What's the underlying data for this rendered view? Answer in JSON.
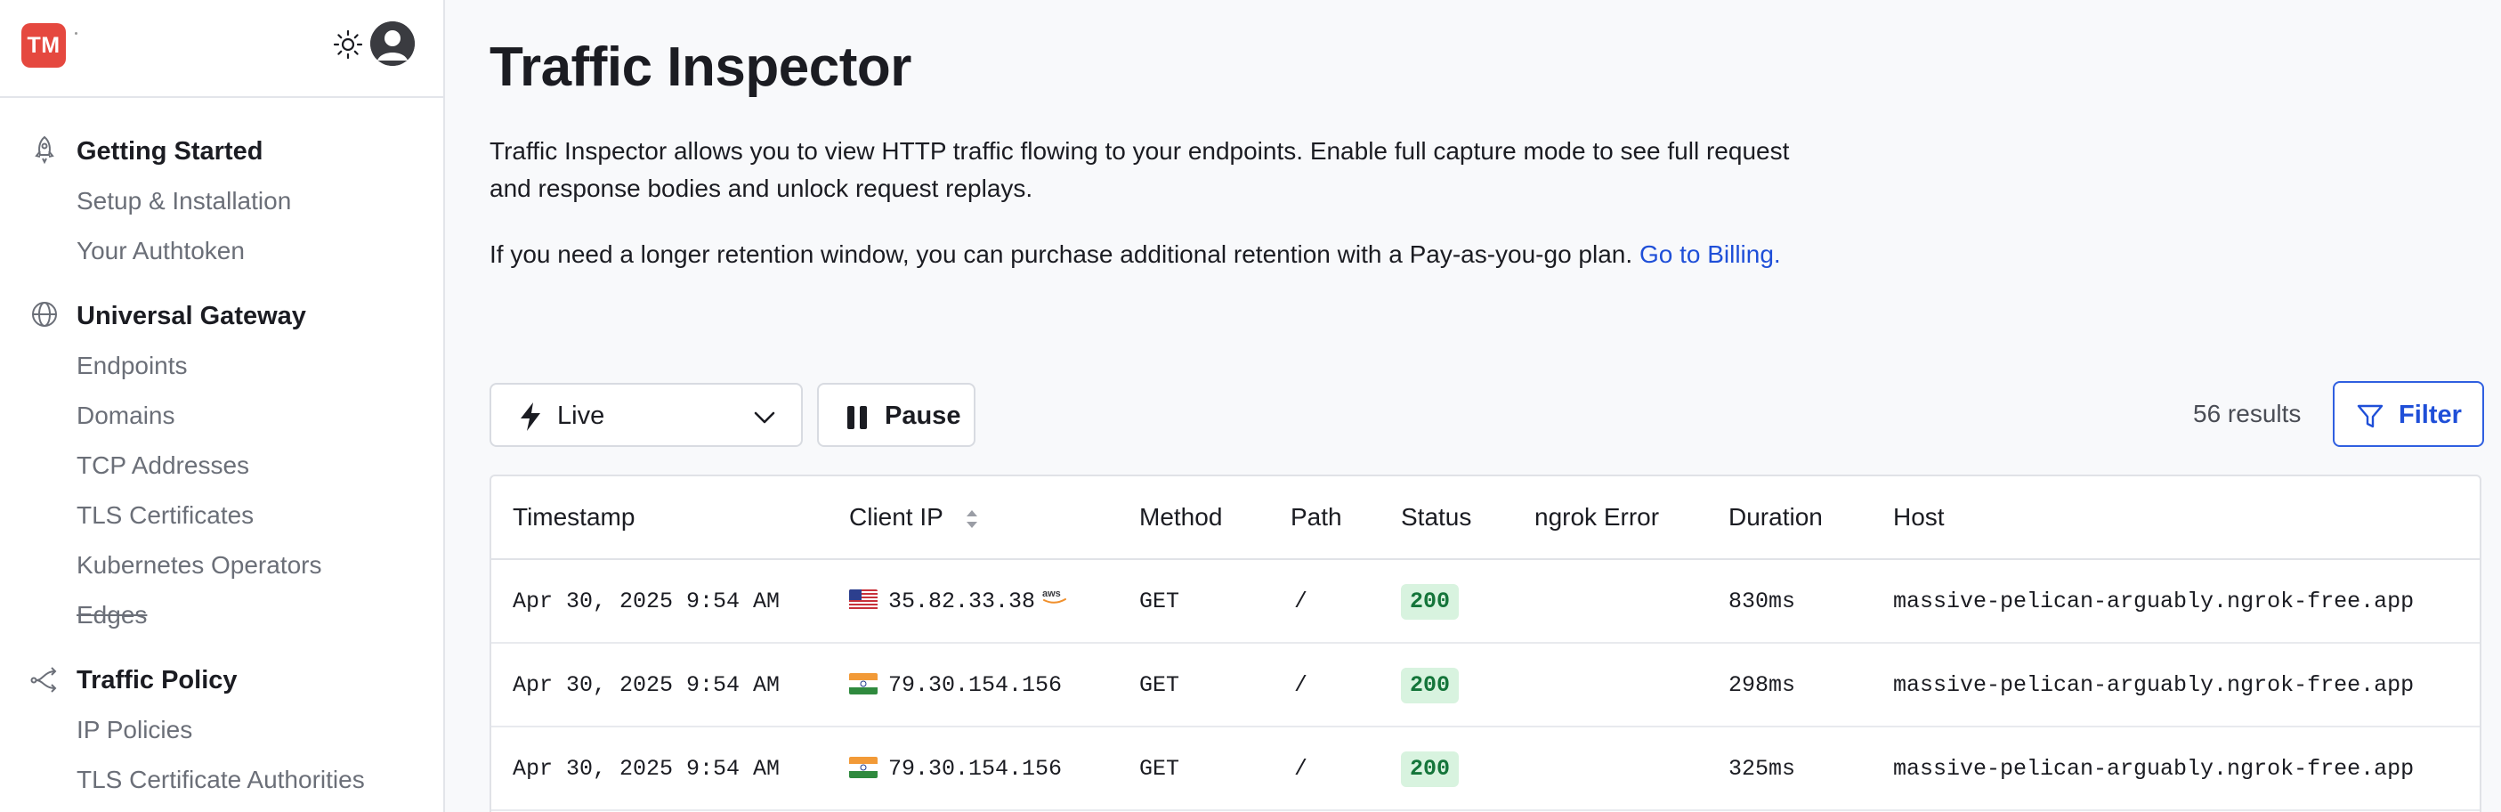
{
  "brand": {
    "initials": "TM"
  },
  "sidebar": {
    "groups": [
      {
        "title": "Getting Started",
        "icon": "rocket-icon",
        "items": [
          "Setup & Installation",
          "Your Authtoken"
        ]
      },
      {
        "title": "Universal Gateway",
        "icon": "globe-icon",
        "items": [
          "Endpoints",
          "Domains",
          "TCP Addresses",
          "TLS Certificates",
          "Kubernetes Operators",
          "Edges"
        ]
      },
      {
        "title": "Traffic Policy",
        "icon": "traffic-policy-icon",
        "items": [
          "IP Policies",
          "TLS Certificate Authorities"
        ]
      }
    ]
  },
  "page": {
    "title": "Traffic Inspector",
    "desc1": "Traffic Inspector allows you to view HTTP traffic flowing to your endpoints. Enable full capture mode to see full request and response bodies and unlock request replays.",
    "desc2": "If you need a longer retention window, you can purchase additional retention with a Pay-as-you-go plan.",
    "billing_link": "Go to Billing."
  },
  "toolbar": {
    "mode_label": "Live",
    "pause_label": "Pause",
    "results": "56 results",
    "filter_label": "Filter"
  },
  "table": {
    "headers": {
      "timestamp": "Timestamp",
      "client_ip": "Client IP",
      "method": "Method",
      "path": "Path",
      "status": "Status",
      "error": "ngrok Error",
      "duration": "Duration",
      "host": "Host"
    },
    "rows": [
      {
        "timestamp": "Apr 30, 2025 9:54 AM",
        "flag": "us-flag-icon",
        "client_ip": "35.82.33.38",
        "provider": "aws-icon",
        "method": "GET",
        "path": "/",
        "status": "200",
        "error": "",
        "duration": "830ms",
        "host": "massive-pelican-arguably.ngrok-free.app"
      },
      {
        "timestamp": "Apr 30, 2025 9:54 AM",
        "flag": "in-flag-icon",
        "client_ip": "79.30.154.156",
        "method": "GET",
        "path": "/",
        "status": "200",
        "error": "",
        "duration": "298ms",
        "host": "massive-pelican-arguably.ngrok-free.app"
      },
      {
        "timestamp": "Apr 30, 2025 9:54 AM",
        "flag": "in-flag-icon",
        "client_ip": "79.30.154.156",
        "method": "GET",
        "path": "/",
        "status": "200",
        "error": "",
        "duration": "325ms",
        "host": "massive-pelican-arguably.ngrok-free.app"
      }
    ]
  },
  "colors": {
    "brand": "#e5483f",
    "link": "#1f4fd8",
    "status_ok_bg": "#d8f3df",
    "status_ok_text": "#14753a"
  }
}
